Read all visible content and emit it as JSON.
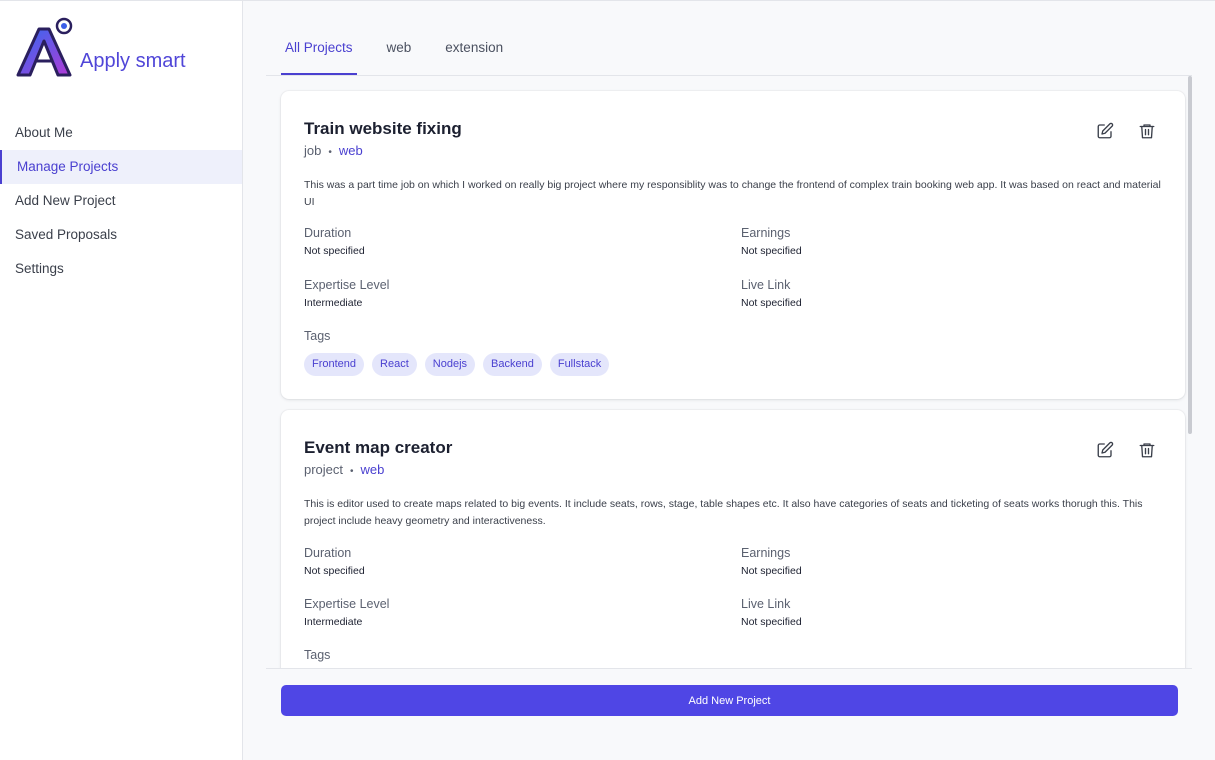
{
  "app": {
    "name": "Apply smart"
  },
  "sidebar": {
    "items": [
      {
        "label": "About Me",
        "active": false
      },
      {
        "label": "Manage Projects",
        "active": true
      },
      {
        "label": "Add New Project",
        "active": false
      },
      {
        "label": "Saved Proposals",
        "active": false
      },
      {
        "label": "Settings",
        "active": false
      }
    ]
  },
  "tabs": [
    {
      "label": "All Projects",
      "active": true
    },
    {
      "label": "web",
      "active": false
    },
    {
      "label": "extension",
      "active": false
    }
  ],
  "projects": [
    {
      "title": "Train website fixing",
      "type": "job",
      "category": "web",
      "description": "This was a part time job on which I worked on really big project where my responsiblity was to change the frontend of complex train booking web app. It was based on react and material UI",
      "duration_label": "Duration",
      "duration": "Not specified",
      "earnings_label": "Earnings",
      "earnings": "Not specified",
      "expertise_label": "Expertise Level",
      "expertise": "Intermediate",
      "live_link_label": "Live Link",
      "live_link": "Not specified",
      "tags_label": "Tags",
      "tags": [
        "Frontend",
        "React",
        "Nodejs",
        "Backend",
        "Fullstack"
      ]
    },
    {
      "title": "Event map creator",
      "type": "project",
      "category": "web",
      "description": "This is editor used to create maps related to big events. It include seats, rows, stage, table shapes etc. It also have categories of seats and ticketing of seats works thorugh this. This project include heavy geometry and interactiveness.",
      "duration_label": "Duration",
      "duration": "Not specified",
      "earnings_label": "Earnings",
      "earnings": "Not specified",
      "expertise_label": "Expertise Level",
      "expertise": "Intermediate",
      "live_link_label": "Live Link",
      "live_link": "Not specified",
      "tags_label": "Tags"
    }
  ],
  "actions": {
    "add_new_project": "Add New Project"
  },
  "icons": {
    "edit": "edit-icon",
    "delete": "trash-icon"
  },
  "colors": {
    "accent": "#4f46e5",
    "tag_bg": "#e4e6fb"
  }
}
